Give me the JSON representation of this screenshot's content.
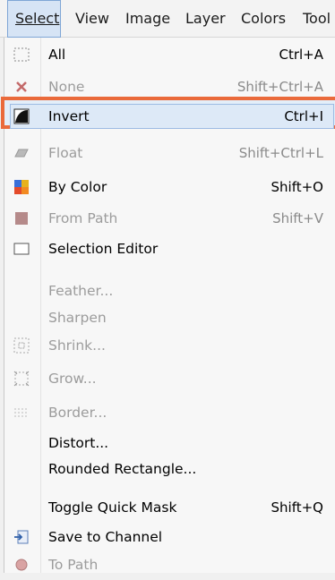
{
  "menubar": {
    "items": [
      "Select",
      "View",
      "Image",
      "Layer",
      "Colors",
      "Tool"
    ]
  },
  "menu": {
    "items": [
      {
        "label": "All",
        "shortcut": "Ctrl+A",
        "icon": "select-all-icon",
        "enabled": true
      },
      {
        "label": "None",
        "shortcut": "Shift+Ctrl+A",
        "icon": "x-icon",
        "enabled": false
      },
      {
        "label": "Invert",
        "shortcut": "Ctrl+I",
        "icon": "invert-icon",
        "enabled": true,
        "highlighted": true
      },
      {
        "label": "Float",
        "shortcut": "Shift+Ctrl+L",
        "icon": "float-icon",
        "enabled": false
      },
      {
        "label": "By Color",
        "shortcut": "Shift+O",
        "icon": "by-color-icon",
        "enabled": true
      },
      {
        "label": "From Path",
        "shortcut": "Shift+V",
        "icon": "from-path-icon",
        "enabled": false
      },
      {
        "label": "Selection Editor",
        "shortcut": "",
        "icon": "selection-editor-icon",
        "enabled": true
      },
      {
        "label": "Feather...",
        "shortcut": "",
        "icon": "",
        "enabled": false
      },
      {
        "label": "Sharpen",
        "shortcut": "",
        "icon": "",
        "enabled": false
      },
      {
        "label": "Shrink...",
        "shortcut": "",
        "icon": "shrink-icon",
        "enabled": false
      },
      {
        "label": "Grow...",
        "shortcut": "",
        "icon": "grow-icon",
        "enabled": false
      },
      {
        "label": "Border...",
        "shortcut": "",
        "icon": "border-icon",
        "enabled": false
      },
      {
        "label": "Distort...",
        "shortcut": "",
        "icon": "",
        "enabled": true
      },
      {
        "label": "Rounded Rectangle...",
        "shortcut": "",
        "icon": "",
        "enabled": true
      },
      {
        "label": "Toggle Quick Mask",
        "shortcut": "Shift+Q",
        "icon": "",
        "enabled": true
      },
      {
        "label": "Save to Channel",
        "shortcut": "",
        "icon": "save-to-channel-icon",
        "enabled": true
      },
      {
        "label": "To Path",
        "shortcut": "",
        "icon": "to-path-icon",
        "enabled": false
      }
    ]
  },
  "colors": {
    "highlight_border": "#ea6a3b",
    "highlight_fill": "#dde9f7",
    "disabled_text": "#9c9c9c"
  }
}
